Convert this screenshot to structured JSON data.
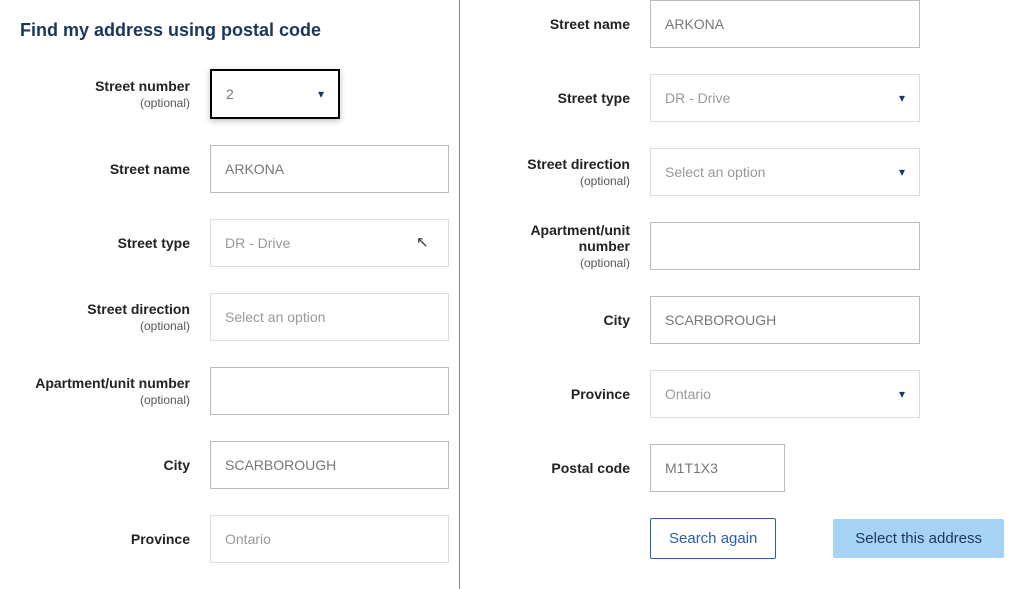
{
  "left": {
    "heading": "Find my address using postal code",
    "street_number_label": "Street number",
    "street_number_optional": "(optional)",
    "street_number_value": "2",
    "street_name_label": "Street name",
    "street_name_value": "ARKONA",
    "street_type_label": "Street type",
    "street_type_value": "DR - Drive",
    "street_direction_label": "Street direction",
    "street_direction_optional": "(optional)",
    "street_direction_placeholder": "Select an option",
    "unit_label": "Apartment/unit number",
    "unit_optional": "(optional)",
    "unit_value": "",
    "city_label": "City",
    "city_value": "SCARBOROUGH",
    "province_label": "Province",
    "province_value": "Ontario"
  },
  "right": {
    "street_name_label": "Street name",
    "street_name_value": "ARKONA",
    "street_type_label": "Street type",
    "street_type_value": "DR - Drive",
    "street_direction_label": "Street direction",
    "street_direction_optional": "(optional)",
    "street_direction_placeholder": "Select an option",
    "unit_label": "Apartment/unit number",
    "unit_optional": "(optional)",
    "unit_value": "",
    "city_label": "City",
    "city_value": "SCARBOROUGH",
    "province_label": "Province",
    "province_value": "Ontario",
    "postal_label": "Postal code",
    "postal_value": "M1T1X3",
    "search_again_label": "Search again",
    "select_address_label": "Select this address"
  }
}
